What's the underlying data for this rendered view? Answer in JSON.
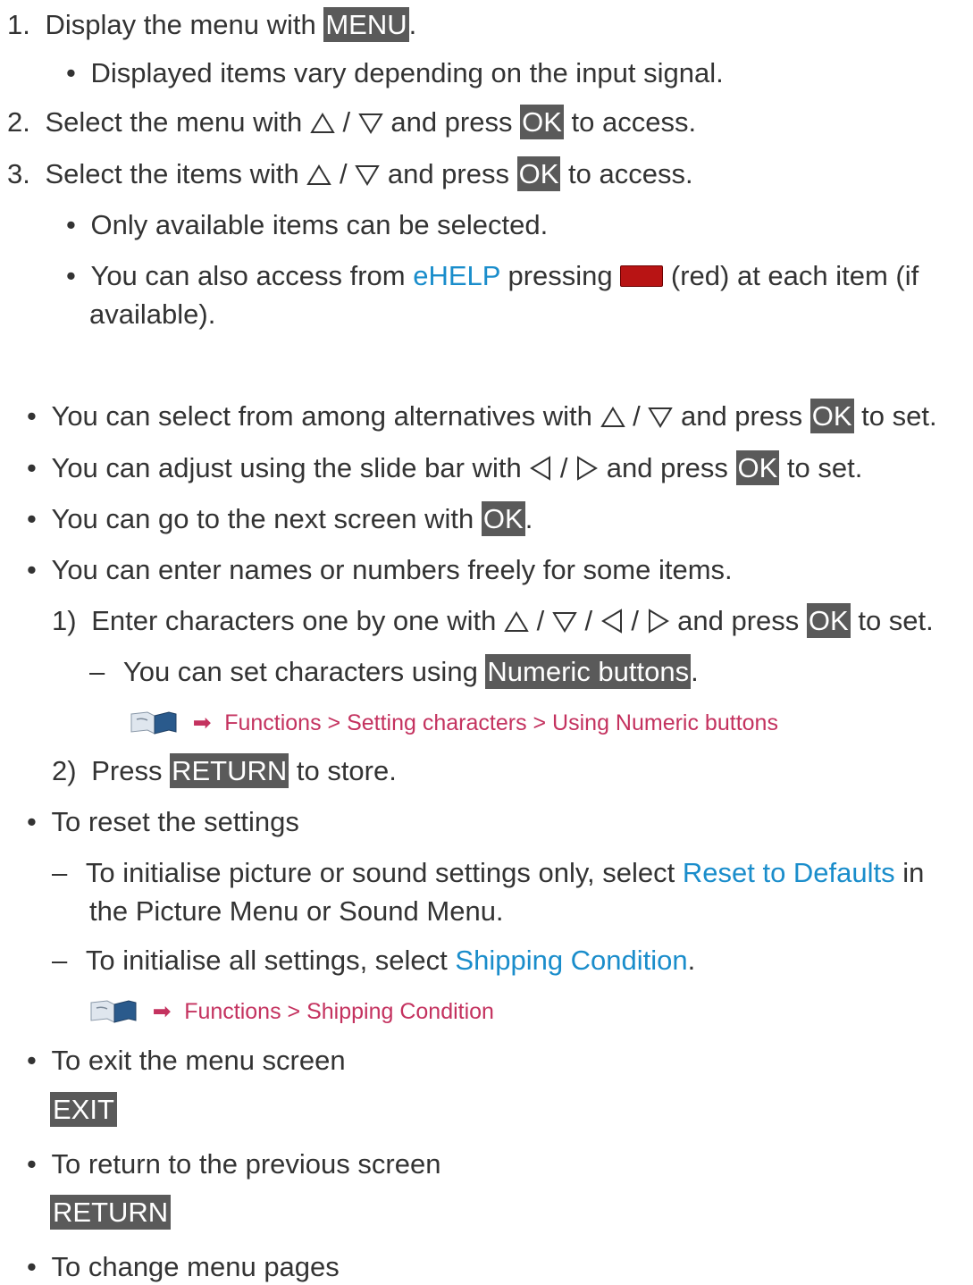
{
  "steps": {
    "s1": {
      "num": "1.",
      "pre": "Display the menu with ",
      "btn": "MENU",
      "post": "."
    },
    "s1_note": {
      "bullet": "•",
      "text": "Displayed items vary depending on the input signal."
    },
    "s2": {
      "num": "2.",
      "pre": "Select the menu with ",
      "sep": " / ",
      "mid": " and press ",
      "btn": "OK",
      "post": " to access."
    },
    "s3": {
      "num": "3.",
      "pre": "Select the items with ",
      "sep": " / ",
      "mid": " and press ",
      "btn": "OK",
      "post": " to access."
    },
    "s3_note1": {
      "bullet": "•",
      "text": "Only available items can be selected."
    },
    "s3_note2": {
      "bullet": "•",
      "pre": "You can also access from ",
      "link": "eHELP",
      "mid": " pressing ",
      "post": " (red) at each item (if",
      "cont": "available)."
    }
  },
  "tips": {
    "t1": {
      "bullet": "•",
      "pre": "You can select from among alternatives with ",
      "sep": " / ",
      "mid": " and press ",
      "btn": "OK",
      "post": " to set."
    },
    "t2": {
      "bullet": "•",
      "pre": "You can adjust using the slide bar with ",
      "sep": " / ",
      "mid": " and press ",
      "btn": "OK",
      "post": " to set."
    },
    "t3": {
      "bullet": "•",
      "pre": "You can go to the next screen with ",
      "btn": "OK",
      "post": "."
    },
    "t4": {
      "bullet": "•",
      "text": "You can enter names or numbers freely for some items."
    },
    "t4_1": {
      "num": "1)",
      "pre": "Enter characters one by one with ",
      "sep": " / ",
      "mid": " and press ",
      "btn": "OK",
      "post": " to set."
    },
    "t4_1_note": {
      "dash": "–",
      "pre": "You can set characters using ",
      "btn": "Numeric buttons",
      "post": "."
    },
    "t4_1_path": "Functions > Setting characters > Using Numeric buttons",
    "t4_2": {
      "num": "2)",
      "pre": "Press ",
      "btn": "RETURN",
      "post": " to store."
    },
    "t5": {
      "bullet": "•",
      "text": "To reset the settings"
    },
    "t5_1": {
      "dash": "–",
      "pre": "To initialise picture or sound settings only, select ",
      "link": "Reset to Defaults",
      "post": " in",
      "cont": "the Picture Menu or Sound Menu."
    },
    "t5_2": {
      "dash": "–",
      "pre": "To initialise all settings, select ",
      "link": "Shipping Condition",
      "post": "."
    },
    "t5_2_path": "Functions > Shipping Condition",
    "t6": {
      "bullet": "•",
      "text": "To exit the menu screen",
      "btn": "EXIT"
    },
    "t7": {
      "bullet": "•",
      "text": "To return to the previous screen",
      "btn": "RETURN"
    },
    "t8": {
      "bullet": "•",
      "text": "To change menu pages"
    }
  },
  "colors": {
    "button_bg": "#5a5a5a",
    "link": "#1a8dcb",
    "path": "#c4325f",
    "red_key": "#b81414"
  },
  "icons": [
    "up-triangle-icon",
    "down-triangle-icon",
    "left-triangle-icon",
    "right-triangle-icon",
    "red-key-icon",
    "ehelp-book-icon",
    "arrow-right-icon"
  ]
}
